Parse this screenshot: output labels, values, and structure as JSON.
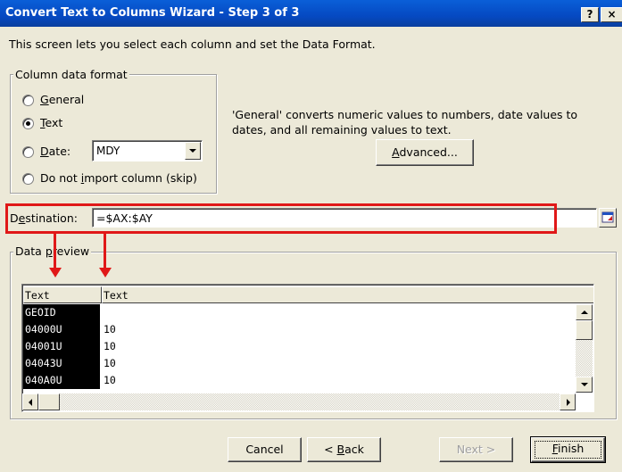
{
  "window": {
    "title": "Convert Text to Columns Wizard - Step 3 of 3",
    "help_label": "?",
    "close_label": "×"
  },
  "intro_text": "This screen lets you select each column and set the Data Format.",
  "column_format": {
    "legend": "Column data format",
    "options": [
      {
        "label_pre": "",
        "label_key": "G",
        "label_post": "eneral",
        "selected": false
      },
      {
        "label_pre": "",
        "label_key": "T",
        "label_post": "ext",
        "selected": true
      },
      {
        "label_pre": "",
        "label_key": "D",
        "label_post": "ate:",
        "selected": false
      },
      {
        "label_pre": "Do not ",
        "label_key": "i",
        "label_post": "mport column (skip)",
        "selected": false
      }
    ],
    "date_format": "MDY"
  },
  "general_description": "'General' converts numeric values to numbers, date values to dates, and all remaining values to text.",
  "advanced_button": {
    "key": "A",
    "rest": "dvanced..."
  },
  "destination": {
    "label_pre": "D",
    "label_key": "e",
    "label_post": "stination:",
    "value": "=$AX:$AY"
  },
  "preview": {
    "legend_pre": "Data ",
    "legend_key": "p",
    "legend_post": "review",
    "headers": [
      "Text",
      "Text"
    ],
    "rows": [
      [
        "GEOID",
        ""
      ],
      [
        "04000U",
        "10"
      ],
      [
        "04001U",
        "10"
      ],
      [
        "04043U",
        "10"
      ],
      [
        "040A0U",
        "10"
      ]
    ]
  },
  "buttons": {
    "cancel": "Cancel",
    "back_pre": "< ",
    "back_key": "B",
    "back_post": "ack",
    "next": "Next >",
    "finish_key": "F",
    "finish_post": "inish"
  },
  "colors": {
    "annotation_red": "#e01818",
    "titlebar_blue": "#0549c2",
    "dialog_bg": "#ece9d8"
  }
}
